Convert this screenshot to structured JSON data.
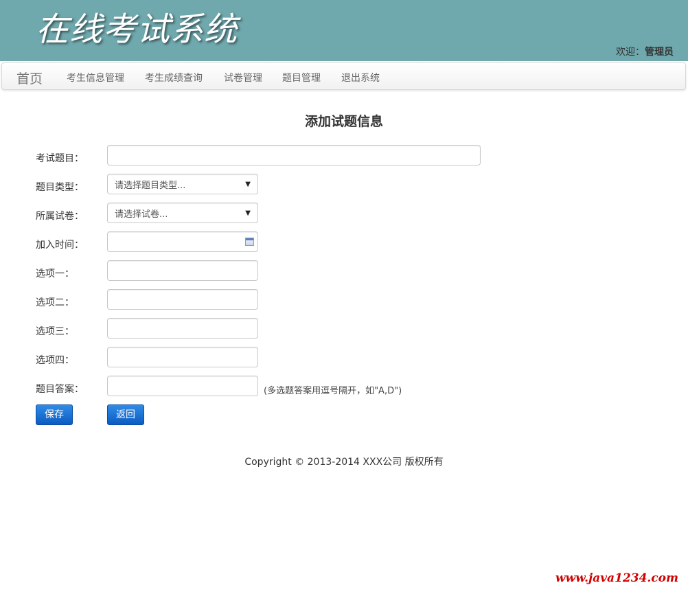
{
  "header": {
    "logo_text": "在线考试系统",
    "welcome_prefix": "欢迎：",
    "welcome_user": "管理员"
  },
  "nav": {
    "brand": "首页",
    "items": [
      "考生信息管理",
      "考生成绩查询",
      "试卷管理",
      "题目管理",
      "退出系统"
    ]
  },
  "form": {
    "title": "添加试题信息",
    "labels": {
      "subject": "考试题目：",
      "type": "题目类型：",
      "paper": "所属试卷：",
      "join_time": "加入时间：",
      "option1": "选项一：",
      "option2": "选项二：",
      "option3": "选项三：",
      "option4": "选项四：",
      "answer": "题目答案："
    },
    "values": {
      "subject": "",
      "join_time": "",
      "option1": "",
      "option2": "",
      "option3": "",
      "option4": "",
      "answer": ""
    },
    "type_selected": "请选择题目类型...",
    "paper_selected": "请选择试卷...",
    "answer_hint": "(多选题答案用逗号隔开，如\"A,D\")",
    "save_label": "保存",
    "back_label": "返回"
  },
  "footer": {
    "copyright": "Copyright © 2013-2014 XXX公司 版权所有"
  },
  "watermark": "www.java1234.com",
  "colors": {
    "header_bg": "#6fa8ad",
    "button_blue": "#0b5cc2",
    "watermark_red": "#d40000"
  },
  "icons": {
    "select_caret": "caret-down-icon",
    "date_picker": "calendar-icon"
  }
}
